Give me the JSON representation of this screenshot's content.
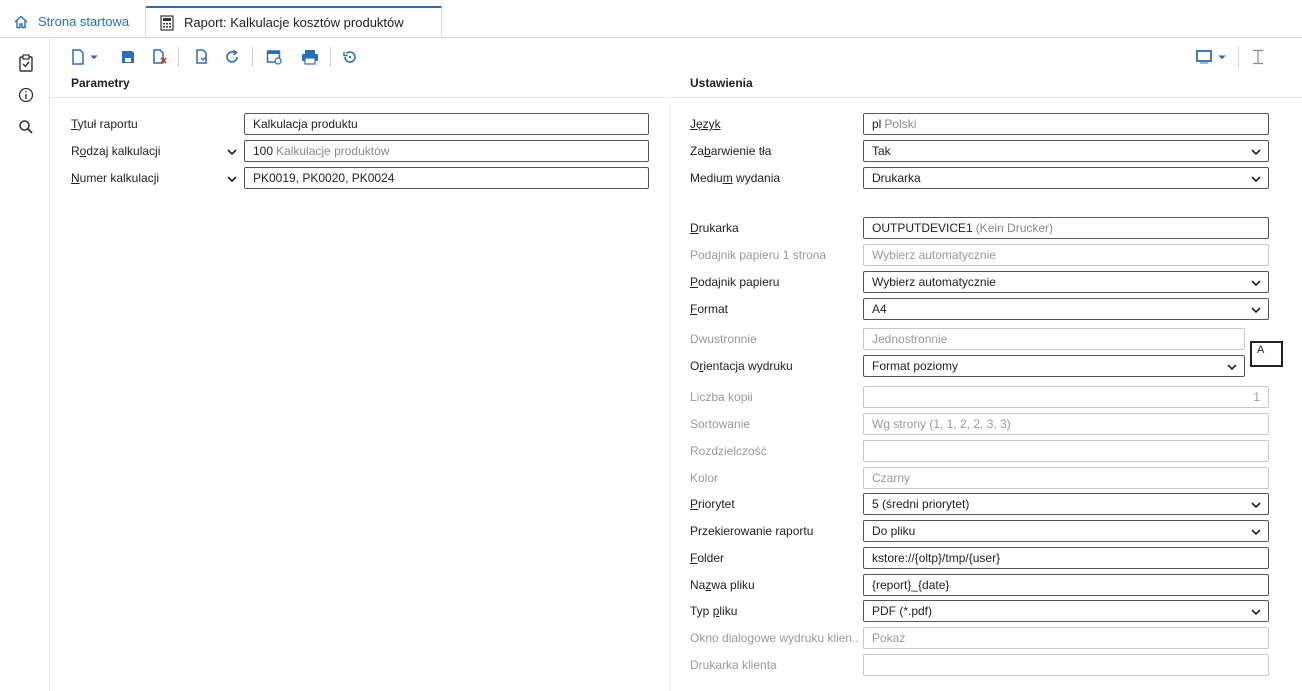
{
  "tabs": {
    "home_label": "Strona startowa",
    "active_label": "Raport: Kalkulacje kosztów produktów"
  },
  "sections": {
    "left_title": "Parametry",
    "right_title": "Ustawienia"
  },
  "params": {
    "title_label_u": "T",
    "title_label_rest": "ytuł raportu",
    "title_value": "Kalkulacja produktu",
    "kind_label_a": "R",
    "kind_label_u": "o",
    "kind_label_b": "dzaj kalkulacji",
    "kind_code": "100",
    "kind_desc": "Kalkulacje produktów",
    "number_label_u": "N",
    "number_label_rest": "umer kalkulacji",
    "number_value": "PK0019, PK0020, PK0024"
  },
  "settings": {
    "lang_label_a": "Język",
    "lang_code": "pl",
    "lang_desc": "Polski",
    "bg_label_a": "Za",
    "bg_label_u": "b",
    "bg_label_b": "arwienie tła",
    "bg_value": "Tak",
    "medium_label_a": "Mediu",
    "medium_label_u": "m",
    "medium_label_b": " wydania",
    "medium_value": "Drukarka",
    "printer_label_u": "D",
    "printer_label_b": "rukarka",
    "printer_code": "OUTPUTDEVICE1",
    "printer_desc": "(Kein Drucker)",
    "tray1_label": "Podajnik papieru 1 strona",
    "tray1_value": "Wybierz automatycznie",
    "tray_label_u": "P",
    "tray_label_b": "odajnik papieru",
    "tray_value": "Wybierz automatycznie",
    "format_label_u": "F",
    "format_label_b": "ormat",
    "format_value": "A4",
    "duplex_label": "Dwustronnie",
    "duplex_value": "Jednostronnie",
    "orient_label_a": "O",
    "orient_label_u": "r",
    "orient_label_b": "ientacja wydruku",
    "orient_value": "Format poziomy",
    "copies_label": "Liczba kopii",
    "copies_value": "1",
    "sort_label": "Sortowanie",
    "sort_value": "Wg strony (1, 1, 2, 2, 3, 3)",
    "resolution_label": "Rozdzielczość",
    "resolution_value": "",
    "color_label": "Kolor",
    "color_value": "Czarny",
    "priority_label_u": "P",
    "priority_label_b": "riorytet",
    "priority_value": "5 (średni priorytet)",
    "redirect_label": "Przekierowanie raportu",
    "redirect_value": "Do pliku",
    "folder_label_u": "F",
    "folder_label_b": "older",
    "folder_value": "kstore://{oltp}/tmp/{user}",
    "filename_label_a": "Na",
    "filename_label_u": "z",
    "filename_label_b": "wa pliku",
    "filename_value": "{report}_{date}",
    "filetype_label_a": "Typ ",
    "filetype_label_u": "p",
    "filetype_label_b": "liku",
    "filetype_value": "PDF (*.pdf)",
    "clientdlg_label": "Okno dialogowe wydruku klien...",
    "clientdlg_value": "Pokaż",
    "clientprinter_label": "Drukarka klienta",
    "clientprinter_value": ""
  },
  "overlay_box": "A",
  "colors": {
    "accent": "#2a6ebb",
    "border": "#555555",
    "disabled": "#9a9a9a"
  }
}
